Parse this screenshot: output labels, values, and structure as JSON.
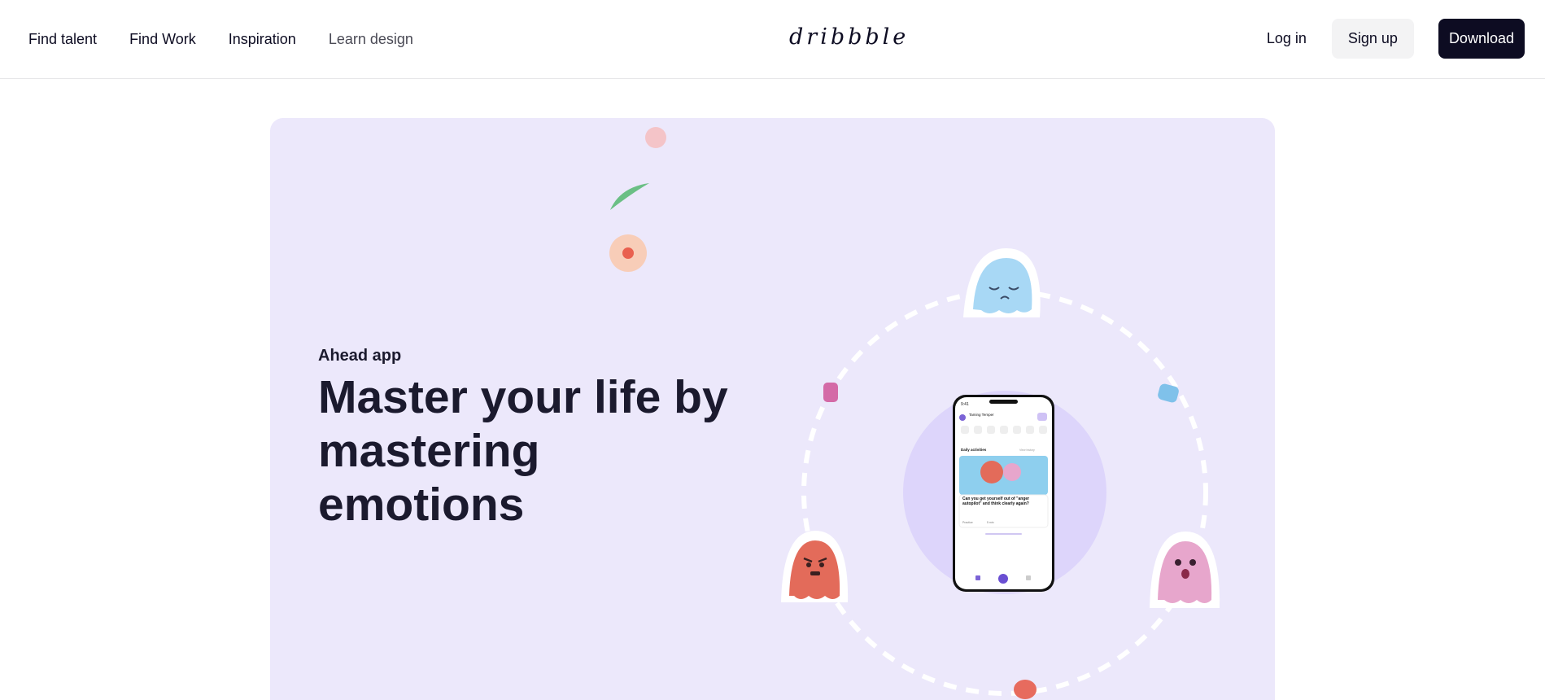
{
  "header": {
    "nav": [
      {
        "label": "Find talent"
      },
      {
        "label": "Find Work"
      },
      {
        "label": "Inspiration"
      },
      {
        "label": "Learn design"
      }
    ],
    "logo_text": "dribbble",
    "login_label": "Log in",
    "signup_label": "Sign up",
    "download_label": "Download"
  },
  "hero": {
    "eyebrow": "Ahead app",
    "headline": "Master your life by mastering emotions",
    "background_color": "#ece8fb",
    "phone": {
      "time": "9:41",
      "app_title": "Taming Temper",
      "section_title": "Daily activities",
      "section_link": "View history",
      "card_text": "Can you get yourself out of \"anger autopilot\" and think clearly again?",
      "card_tag": "Practice",
      "card_time": "5 min"
    }
  },
  "colors": {
    "brand_dark": "#0d0c22",
    "hero_bg": "#ece8fb",
    "ghost_blue": "#a8d8f5",
    "ghost_pink": "#e7a6cc",
    "ghost_red": "#e36b5a"
  }
}
